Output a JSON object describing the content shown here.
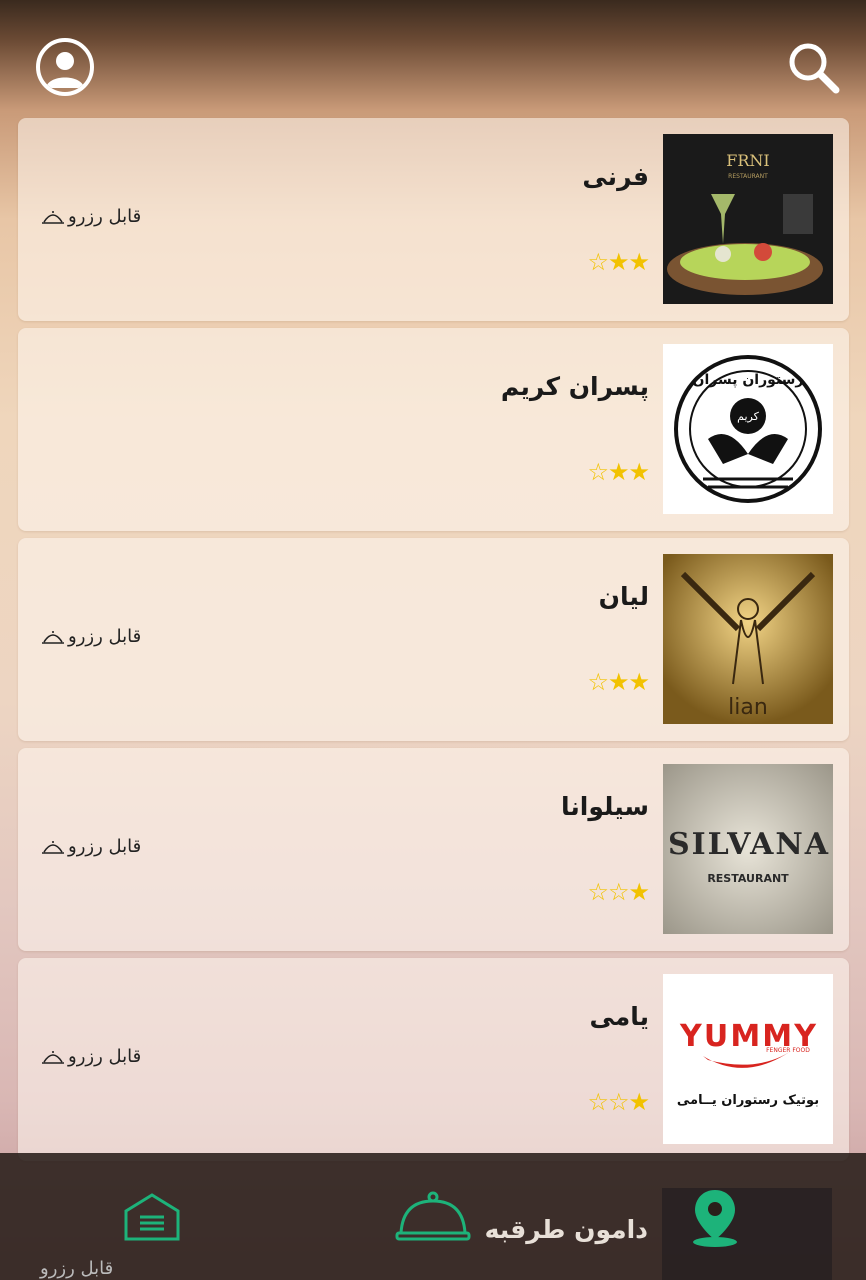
{
  "header": {
    "profile_icon": "user-circle-icon",
    "search_icon": "search-icon"
  },
  "restaurants": [
    {
      "name": "فرنی",
      "stars": 2,
      "max_stars": 3,
      "reserve": "قابل رزرو",
      "thumb_text": "FRNI"
    },
    {
      "name": "پسران کریم",
      "stars": 2,
      "max_stars": 3,
      "reserve": "",
      "thumb_text": "کریم"
    },
    {
      "name": "لیان",
      "stars": 2,
      "max_stars": 3,
      "reserve": "قابل رزرو",
      "thumb_text": "lian"
    },
    {
      "name": "سیلوانا",
      "stars": 1,
      "max_stars": 3,
      "reserve": "قابل رزرو",
      "thumb_text": "SILVANA"
    },
    {
      "name": "یامی",
      "stars": 1,
      "max_stars": 3,
      "reserve": "قابل رزرو",
      "thumb_text": "YUMMY"
    }
  ],
  "peek": {
    "name": "دامون طرقبه",
    "reserve": "قابل رزرو"
  },
  "thumb_sub": {
    "frni": "RESTAURANT",
    "karim_ring": "رستوران پسران",
    "silvana": "RESTAURANT",
    "yummy_sub": "FENGER FOOD",
    "yummy_fa": "بوتیک رستوران یــامی"
  },
  "bottom_nav": [
    {
      "icon": "home-list-icon"
    },
    {
      "icon": "cloche-icon"
    },
    {
      "icon": "map-pin-icon"
    }
  ],
  "colors": {
    "accent": "#1db37a",
    "star": "#f2c200",
    "bar": "#2a1f1a"
  }
}
